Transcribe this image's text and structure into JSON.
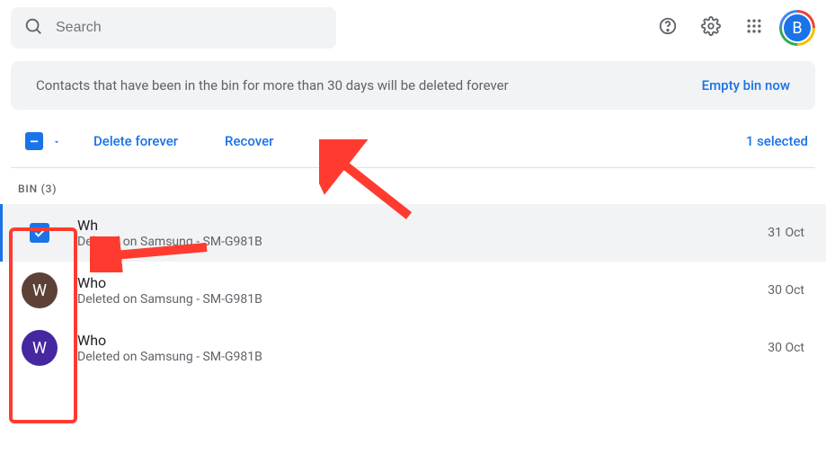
{
  "header": {
    "search_placeholder": "Search",
    "avatar_initial": "B"
  },
  "notice": {
    "message": "Contacts that have been in the bin for more than 30 days will be deleted forever",
    "action": "Empty bin now"
  },
  "toolbar": {
    "delete_label": "Delete forever",
    "recover_label": "Recover",
    "selected_text": "1 selected"
  },
  "section": {
    "label": "BIN (3)"
  },
  "contacts": [
    {
      "name": "Wh",
      "subtitle": "Deleted on Samsung - SM-G981B",
      "date": "31 Oct",
      "selected": true,
      "avatar_bg": "",
      "initial": ""
    },
    {
      "name": "Who",
      "subtitle": "Deleted on Samsung - SM-G981B",
      "date": "30 Oct",
      "selected": false,
      "avatar_bg": "brown",
      "initial": "W"
    },
    {
      "name": "Who",
      "subtitle": "Deleted on Samsung - SM-G981B",
      "date": "30 Oct",
      "selected": false,
      "avatar_bg": "purple",
      "initial": "W"
    }
  ]
}
